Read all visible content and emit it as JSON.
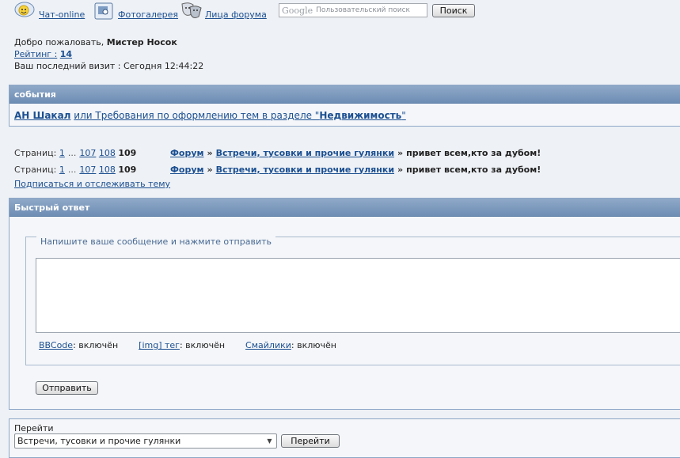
{
  "nav": {
    "chat_label": "Чат-online",
    "gallery_label": "Фотогалерея",
    "faces_label": "Лица форума"
  },
  "search": {
    "logo_text": "Google",
    "placeholder": "Пользовательский поиск",
    "button_label": "Поиск"
  },
  "welcome": {
    "greeting": "Добро пожаловать,",
    "username": "Мистер Носок",
    "rating_label": "Рейтинг :",
    "rating_value": "14",
    "last_visit": "Ваш последний визит : Сегодня 12:44:22"
  },
  "events": {
    "title": "события",
    "author": "АН Шакал",
    "text_mid": "или Требования по оформлению тем в разделе \"",
    "section": "Недвижимость",
    "text_end": "\""
  },
  "pagination": {
    "label": "Страниц:",
    "first": "1",
    "ellipsis": "...",
    "p107": "107",
    "p108": "108",
    "current": "109"
  },
  "breadcrumb": {
    "forum": "Форум",
    "arrow": "»",
    "subforum": "Встречи, тусовки и прочие гулянки",
    "topic": "привет всем,кто за дубом!"
  },
  "subscribe_link": "Подписаться и отслеживать тему",
  "quick_reply": {
    "title": "Быстрый ответ",
    "legend": "Напишите ваше сообщение и нажмите отправить",
    "message": "",
    "bbcode_label": "BBCode",
    "bbcode_state": ": включён",
    "img_label": "[img] тег",
    "img_state": ": включён",
    "smilies_label": "Смайлики",
    "smilies_state": ": включён",
    "submit_label": "Отправить"
  },
  "jump": {
    "label": "Перейти",
    "selected": "Встречи, тусовки и прочие гулянки",
    "button_label": "Перейти"
  },
  "colors": {
    "header_gradient_top": "#8fa9c8",
    "header_gradient_bottom": "#6e8db4",
    "link": "#1b4f91",
    "background": "#eef1f5"
  }
}
